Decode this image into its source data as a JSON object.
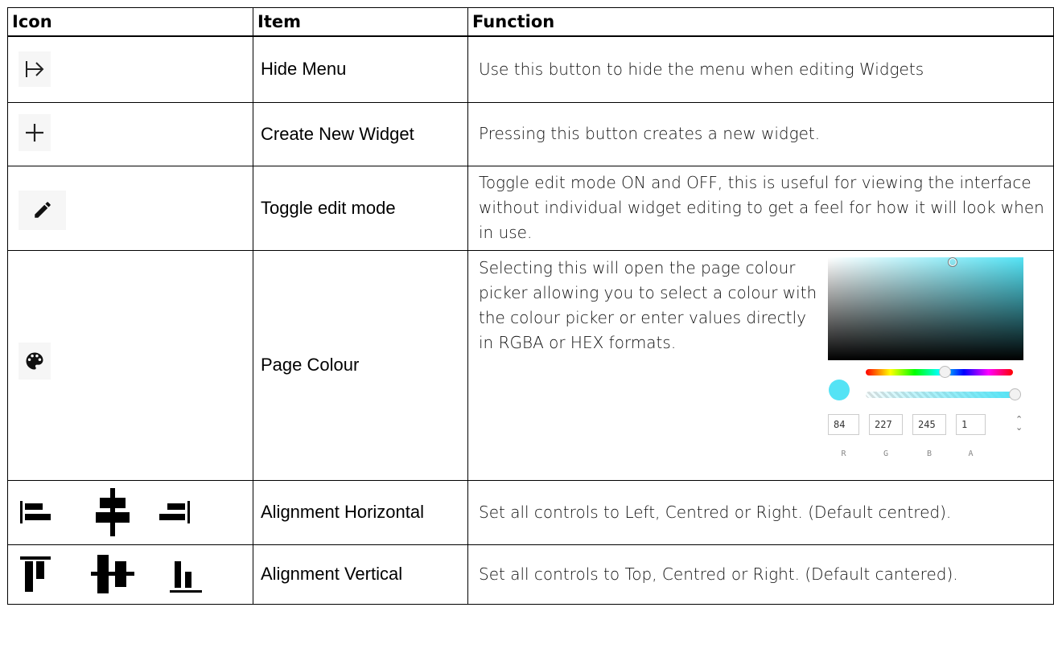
{
  "headers": {
    "icon": "Icon",
    "item": "Item",
    "function": "Function"
  },
  "rows": [
    {
      "icon": "hide-menu-icon",
      "item": "Hide Menu",
      "function": "Use this button to hide the menu when editing Widgets"
    },
    {
      "icon": "plus-icon",
      "item": "Create New Widget",
      "function": "Pressing this button creates a new widget."
    },
    {
      "icon": "pencil-icon",
      "item": "Toggle edit mode",
      "function": "Toggle edit mode ON and OFF, this is useful for viewing the interface without individual widget editing to get a feel for how it will look when in use."
    },
    {
      "icon": "palette-icon",
      "item": "Page Colour",
      "function": "Selecting this will open the page colour picker allowing you to select a colour with the colour picker or enter values directly in RGBA or HEX formats."
    },
    {
      "icon": "align-horizontal-icons",
      "item": "Alignment Horizontal",
      "function": "Set all controls to Left, Centred or Right. (Default centred)."
    },
    {
      "icon": "align-vertical-icons",
      "item": "Alignment Vertical",
      "function": "Set all controls to Top, Centred or Right. (Default cantered)."
    }
  ],
  "color_picker": {
    "color": "#54e3f5",
    "r": "84",
    "g": "227",
    "b": "245",
    "a": "1",
    "labels": {
      "r": "R",
      "g": "G",
      "b": "B",
      "a": "A"
    }
  }
}
